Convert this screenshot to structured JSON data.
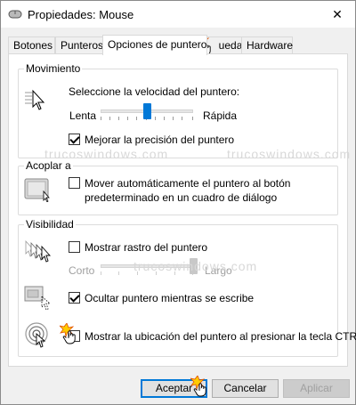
{
  "window": {
    "title": "Propiedades: Mouse",
    "close_symbol": "✕"
  },
  "tabs": [
    {
      "label": "Botones",
      "active": false
    },
    {
      "label": "Punteros",
      "active": false
    },
    {
      "label": "Opciones de puntero",
      "active": true
    },
    {
      "label": "Rueda",
      "active": false
    },
    {
      "label": "Hardware",
      "active": false
    }
  ],
  "movimiento": {
    "title": "Movimiento",
    "speed_label": "Seleccione la velocidad del puntero:",
    "slow_label": "Lenta",
    "fast_label": "Rápida",
    "speed_value_fraction": 0.5,
    "precision_label": "Mejorar la precisión del puntero",
    "precision_checked": true
  },
  "acoplar": {
    "title": "Acoplar a",
    "snap_label_line1": "Mover automáticamente el puntero al botón",
    "snap_label_line2": "predeterminado en un cuadro de diálogo",
    "snap_checked": false
  },
  "visibilidad": {
    "title": "Visibilidad",
    "trail_label": "Mostrar rastro del puntero",
    "trail_checked": false,
    "short_label": "Corto",
    "long_label": "Largo",
    "trail_value_fraction": 1.0,
    "hide_label": "Ocultar puntero mientras se escribe",
    "hide_checked": true,
    "ctrl_label": "Mostrar la ubicación del puntero al presionar la tecla CTRL",
    "ctrl_checked": false
  },
  "buttons": {
    "accept": "Aceptar",
    "cancel": "Cancelar",
    "apply": "Aplicar"
  },
  "watermark": "trucoswindows.com",
  "colors": {
    "accent": "#0078d7",
    "panel_bg": "#ffffff",
    "window_bg": "#f0f0f0",
    "highlight_star": "#ffcc00"
  }
}
